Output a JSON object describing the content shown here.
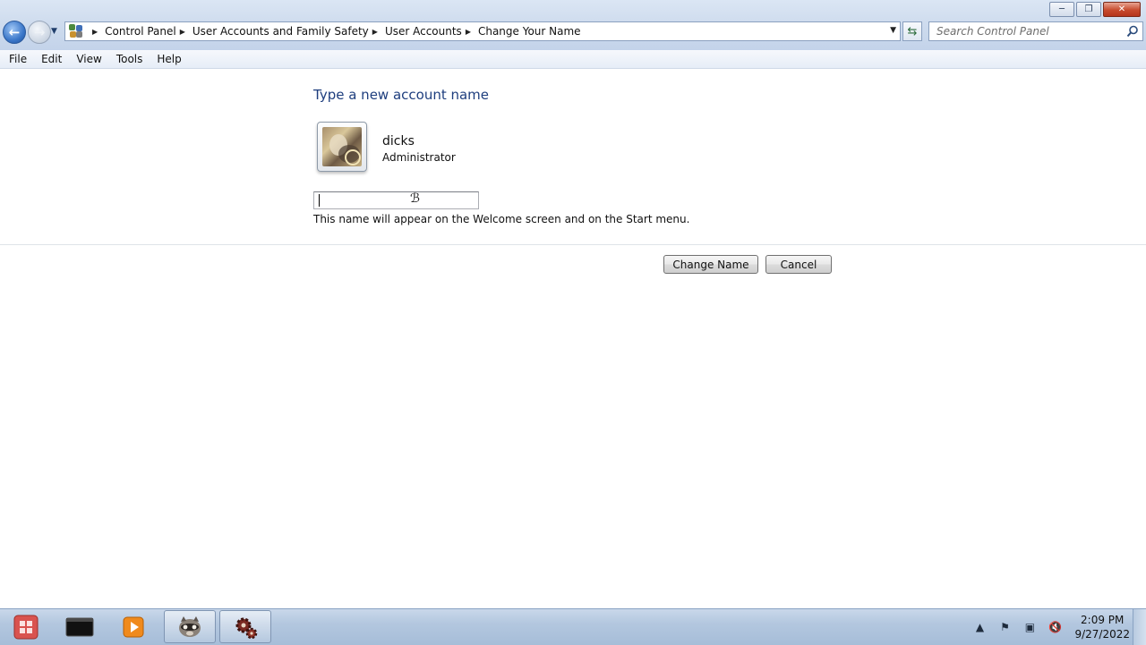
{
  "window": {
    "caption_buttons": [
      "minimize",
      "restore",
      "close"
    ]
  },
  "breadcrumb": {
    "items": [
      "Control Panel",
      "User Accounts and Family Safety",
      "User Accounts",
      "Change Your Name"
    ]
  },
  "search": {
    "placeholder": "Search Control Panel"
  },
  "menubar": {
    "items": [
      "File",
      "Edit",
      "View",
      "Tools",
      "Help"
    ]
  },
  "main": {
    "heading": "Type a new account name",
    "user": {
      "name": "dicks",
      "role": "Administrator"
    },
    "name_input_value": "",
    "hint": "This name will appear on the Welcome screen and on the Start menu.",
    "buttons": {
      "change_name": "Change Name",
      "cancel": "Cancel"
    }
  },
  "taskbar": {
    "apps": [
      "start-orb-icon",
      "terminal-icon",
      "media-player-icon",
      "raccoon-app-icon",
      "gears-app-icon"
    ],
    "clock": {
      "time": "2:09 PM",
      "date": "9/27/2022"
    }
  },
  "colors": {
    "heading": "#1e3e7e",
    "chrome": "#cfdcee",
    "taskbar": "#b3c7df"
  }
}
